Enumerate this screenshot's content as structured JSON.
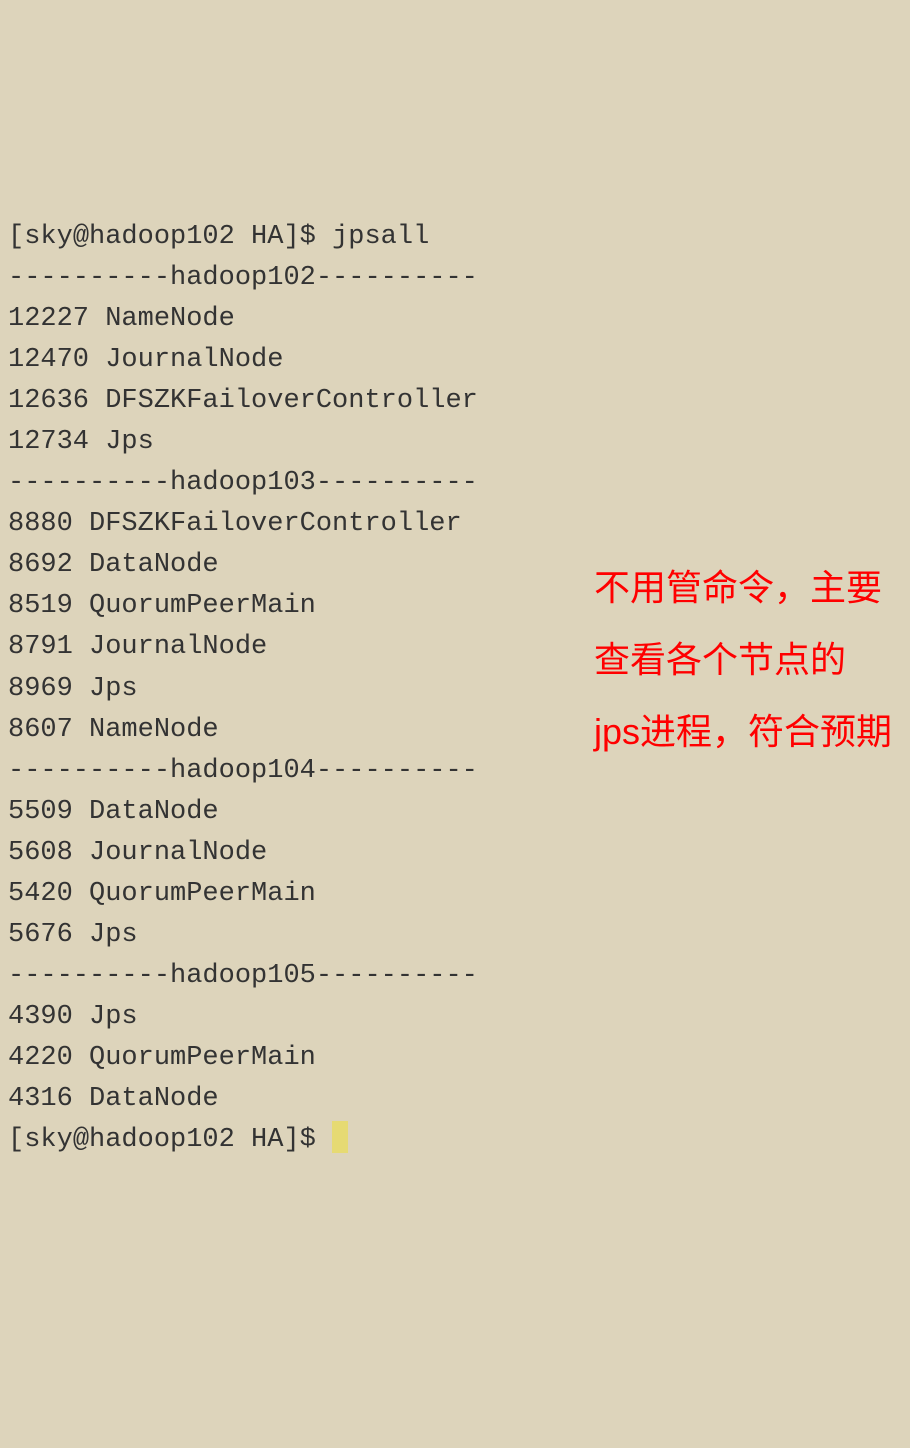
{
  "prompt1": {
    "user": "sky",
    "host": "hadoop102",
    "dir": "HA",
    "symbol": "$",
    "command": "jpsall"
  },
  "hosts": [
    {
      "name": "hadoop102",
      "separator": "----------hadoop102----------",
      "processes": [
        {
          "pid": "12227",
          "name": "NameNode"
        },
        {
          "pid": "12470",
          "name": "JournalNode"
        },
        {
          "pid": "12636",
          "name": "DFSZKFailoverController"
        },
        {
          "pid": "12734",
          "name": "Jps"
        }
      ]
    },
    {
      "name": "hadoop103",
      "separator": "----------hadoop103----------",
      "processes": [
        {
          "pid": "8880",
          "name": "DFSZKFailoverController"
        },
        {
          "pid": "8692",
          "name": "DataNode"
        },
        {
          "pid": "8519",
          "name": "QuorumPeerMain"
        },
        {
          "pid": "8791",
          "name": "JournalNode"
        },
        {
          "pid": "8969",
          "name": "Jps"
        },
        {
          "pid": "8607",
          "name": "NameNode"
        }
      ]
    },
    {
      "name": "hadoop104",
      "separator": "----------hadoop104----------",
      "processes": [
        {
          "pid": "5509",
          "name": "DataNode"
        },
        {
          "pid": "5608",
          "name": "JournalNode"
        },
        {
          "pid": "5420",
          "name": "QuorumPeerMain"
        },
        {
          "pid": "5676",
          "name": "Jps"
        }
      ]
    },
    {
      "name": "hadoop105",
      "separator": "----------hadoop105----------",
      "processes": [
        {
          "pid": "4390",
          "name": "Jps"
        },
        {
          "pid": "4220",
          "name": "QuorumPeerMain"
        },
        {
          "pid": "4316",
          "name": "DataNode"
        }
      ]
    }
  ],
  "prompt2": {
    "user": "sky",
    "host": "hadoop102",
    "dir": "HA",
    "symbol": "$"
  },
  "annotation": {
    "line1": "不用管命令，主要",
    "line2": "查看各个节点的",
    "line3": "jps进程，符合预期"
  }
}
